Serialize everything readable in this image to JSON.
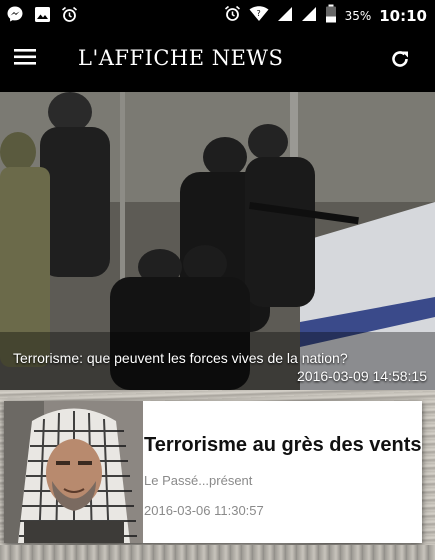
{
  "status_bar": {
    "left_icons": [
      "messenger-icon",
      "image-icon",
      "alarm-icon"
    ],
    "right_icons": [
      "alarm-icon",
      "wifi-icon",
      "signal-icon",
      "signal-icon",
      "battery-icon"
    ],
    "battery_pct": "35%",
    "time": "10:10"
  },
  "app_bar": {
    "title": "L'AFFICHE NEWS",
    "menu_icon": "hamburger-menu-icon",
    "refresh_icon": "refresh-icon",
    "background": "#000000"
  },
  "featured": {
    "caption": "Terrorisme: que peuvent les forces vives de la nation?",
    "date": "2016-03-09 14:58:15"
  },
  "articles": [
    {
      "title": "Terrorisme au grès des vents",
      "category": "Le Passé...présent",
      "date": "2016-03-06 11:30:57"
    }
  ]
}
